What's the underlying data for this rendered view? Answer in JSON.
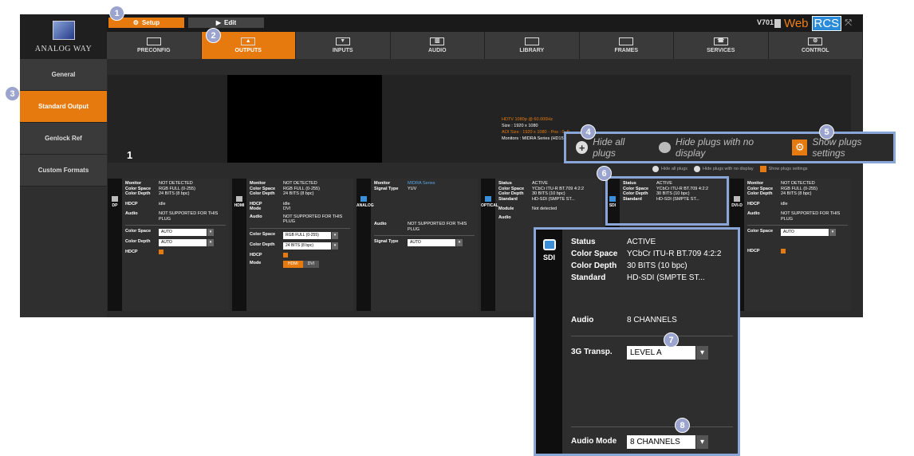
{
  "topbar": {
    "setup_label": "Setup",
    "edit_label": "Edit",
    "version": "V701",
    "brand_web": "Web",
    "brand_rcs": "RCS"
  },
  "logo": {
    "text": "ANALOG WAY"
  },
  "nav": {
    "tabs": [
      "PRECONFIG",
      "OUTPUTS",
      "INPUTS",
      "AUDIO",
      "LIBRARY",
      "FRAMES",
      "SERVICES",
      "CONTROL"
    ],
    "active": "OUTPUTS"
  },
  "sidebar": {
    "items": [
      "General",
      "Standard Output",
      "Genlock Ref",
      "Custom Formats"
    ],
    "active": "Standard Output"
  },
  "preview": {
    "screen_number": "1",
    "format": "HDTV 1080p @ 60.000Hz",
    "size": "Size : 1920 x 1080",
    "aoi": "AOI Size : 1920 x 1080 - Pos : 0, 0",
    "monitors": "Monitors : MIDRA Series (HD15)"
  },
  "plug_controls": {
    "hide_all": "Hide all plugs",
    "hide_no_display": "Hide plugs with no display",
    "show_settings": "Show plugs settings"
  },
  "plugs": {
    "dp": {
      "name": "DP",
      "monitor": "NOT DETECTED",
      "color_space": "RGB FULL (0-255)",
      "color_depth": "24 BITS (8 bpc)",
      "hdcp": "idle",
      "audio": "NOT SUPPORTED FOR THIS PLUG",
      "sel_color_space": "AUTO",
      "sel_color_depth": "AUTO"
    },
    "hdmi": {
      "name": "HDMI",
      "monitor": "NOT DETECTED",
      "color_space": "RGB FULL (0-255)",
      "color_depth": "24 BITS (8 bpc)",
      "hdcp": "idle",
      "mode_value": "DVI",
      "audio": "NOT SUPPORTED FOR THIS PLUG",
      "sel_color_space": "RGB FULL (0-255)",
      "sel_color_depth": "24 BITS (8 bpc)",
      "seg_hdmi": "HDMI",
      "seg_dvi": "DVI"
    },
    "analog": {
      "name": "ANALOG",
      "monitor": "MIDRA Series",
      "signal_type": "YUV",
      "audio": "NOT SUPPORTED FOR THIS PLUG",
      "sel_signal_type": "AUTO"
    },
    "optical": {
      "name": "OPTICAL",
      "status": "ACTIVE",
      "color_space": "YCbCr ITU-R BT.709 4:2:2",
      "color_depth": "30 BITS (10 bpc)",
      "standard": "HD-SDI (SMPTE ST...",
      "module": "Not detected"
    },
    "sdi": {
      "name": "SDI",
      "status": "ACTIVE",
      "color_space": "YCbCr ITU-R BT.709 4:2:2",
      "color_depth": "30 BITS (10 bpc)",
      "standard": "HD-SDI (SMPTE ST..."
    },
    "dvid": {
      "name": "DVI-D",
      "monitor": "NOT DETECTED",
      "color_space": "RGB FULL (0-255)",
      "color_depth": "24 BITS (8 bpc)",
      "hdcp": "idle",
      "audio": "NOT SUPPORTED FOR THIS PLUG",
      "sel_color_space": "AUTO"
    }
  },
  "labels": {
    "monitor": "Monitor",
    "color_space": "Color Space",
    "color_depth": "Color Depth",
    "hdcp": "HDCP",
    "audio": "Audio",
    "mode": "Mode",
    "signal_type": "Signal Type",
    "status": "Status",
    "standard": "Standard",
    "module": "Module",
    "transp": "3G Transp.",
    "audio_mode": "Audio Mode"
  },
  "zoom_sdi": {
    "name": "SDI",
    "status": "ACTIVE",
    "color_space": "YCbCr ITU-R BT.709 4:2:2",
    "color_depth": "30 BITS (10 bpc)",
    "standard": "HD-SDI (SMPTE ST...",
    "audio": "8 CHANNELS",
    "transp": "LEVEL A",
    "audio_mode": "8 CHANNELS"
  },
  "callouts": [
    "1",
    "2",
    "3",
    "4",
    "5",
    "6",
    "7",
    "8"
  ],
  "colors": {
    "accent": "#e77a0e",
    "callout": "#9ba4cf",
    "frame": "#8aa6d8"
  }
}
